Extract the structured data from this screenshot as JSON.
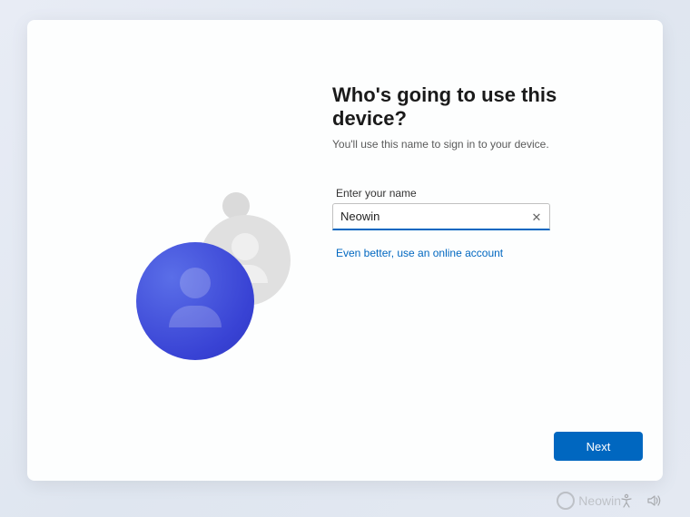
{
  "header": {
    "title": "Who's going to use this device?",
    "subtitle": "You'll use this name to sign in to your device."
  },
  "form": {
    "name_label": "Enter your name",
    "name_value": "Neowin",
    "online_link": "Even better, use an online account"
  },
  "actions": {
    "next_label": "Next"
  },
  "watermark": {
    "text": "Neowin"
  },
  "colors": {
    "accent": "#0067c0"
  }
}
